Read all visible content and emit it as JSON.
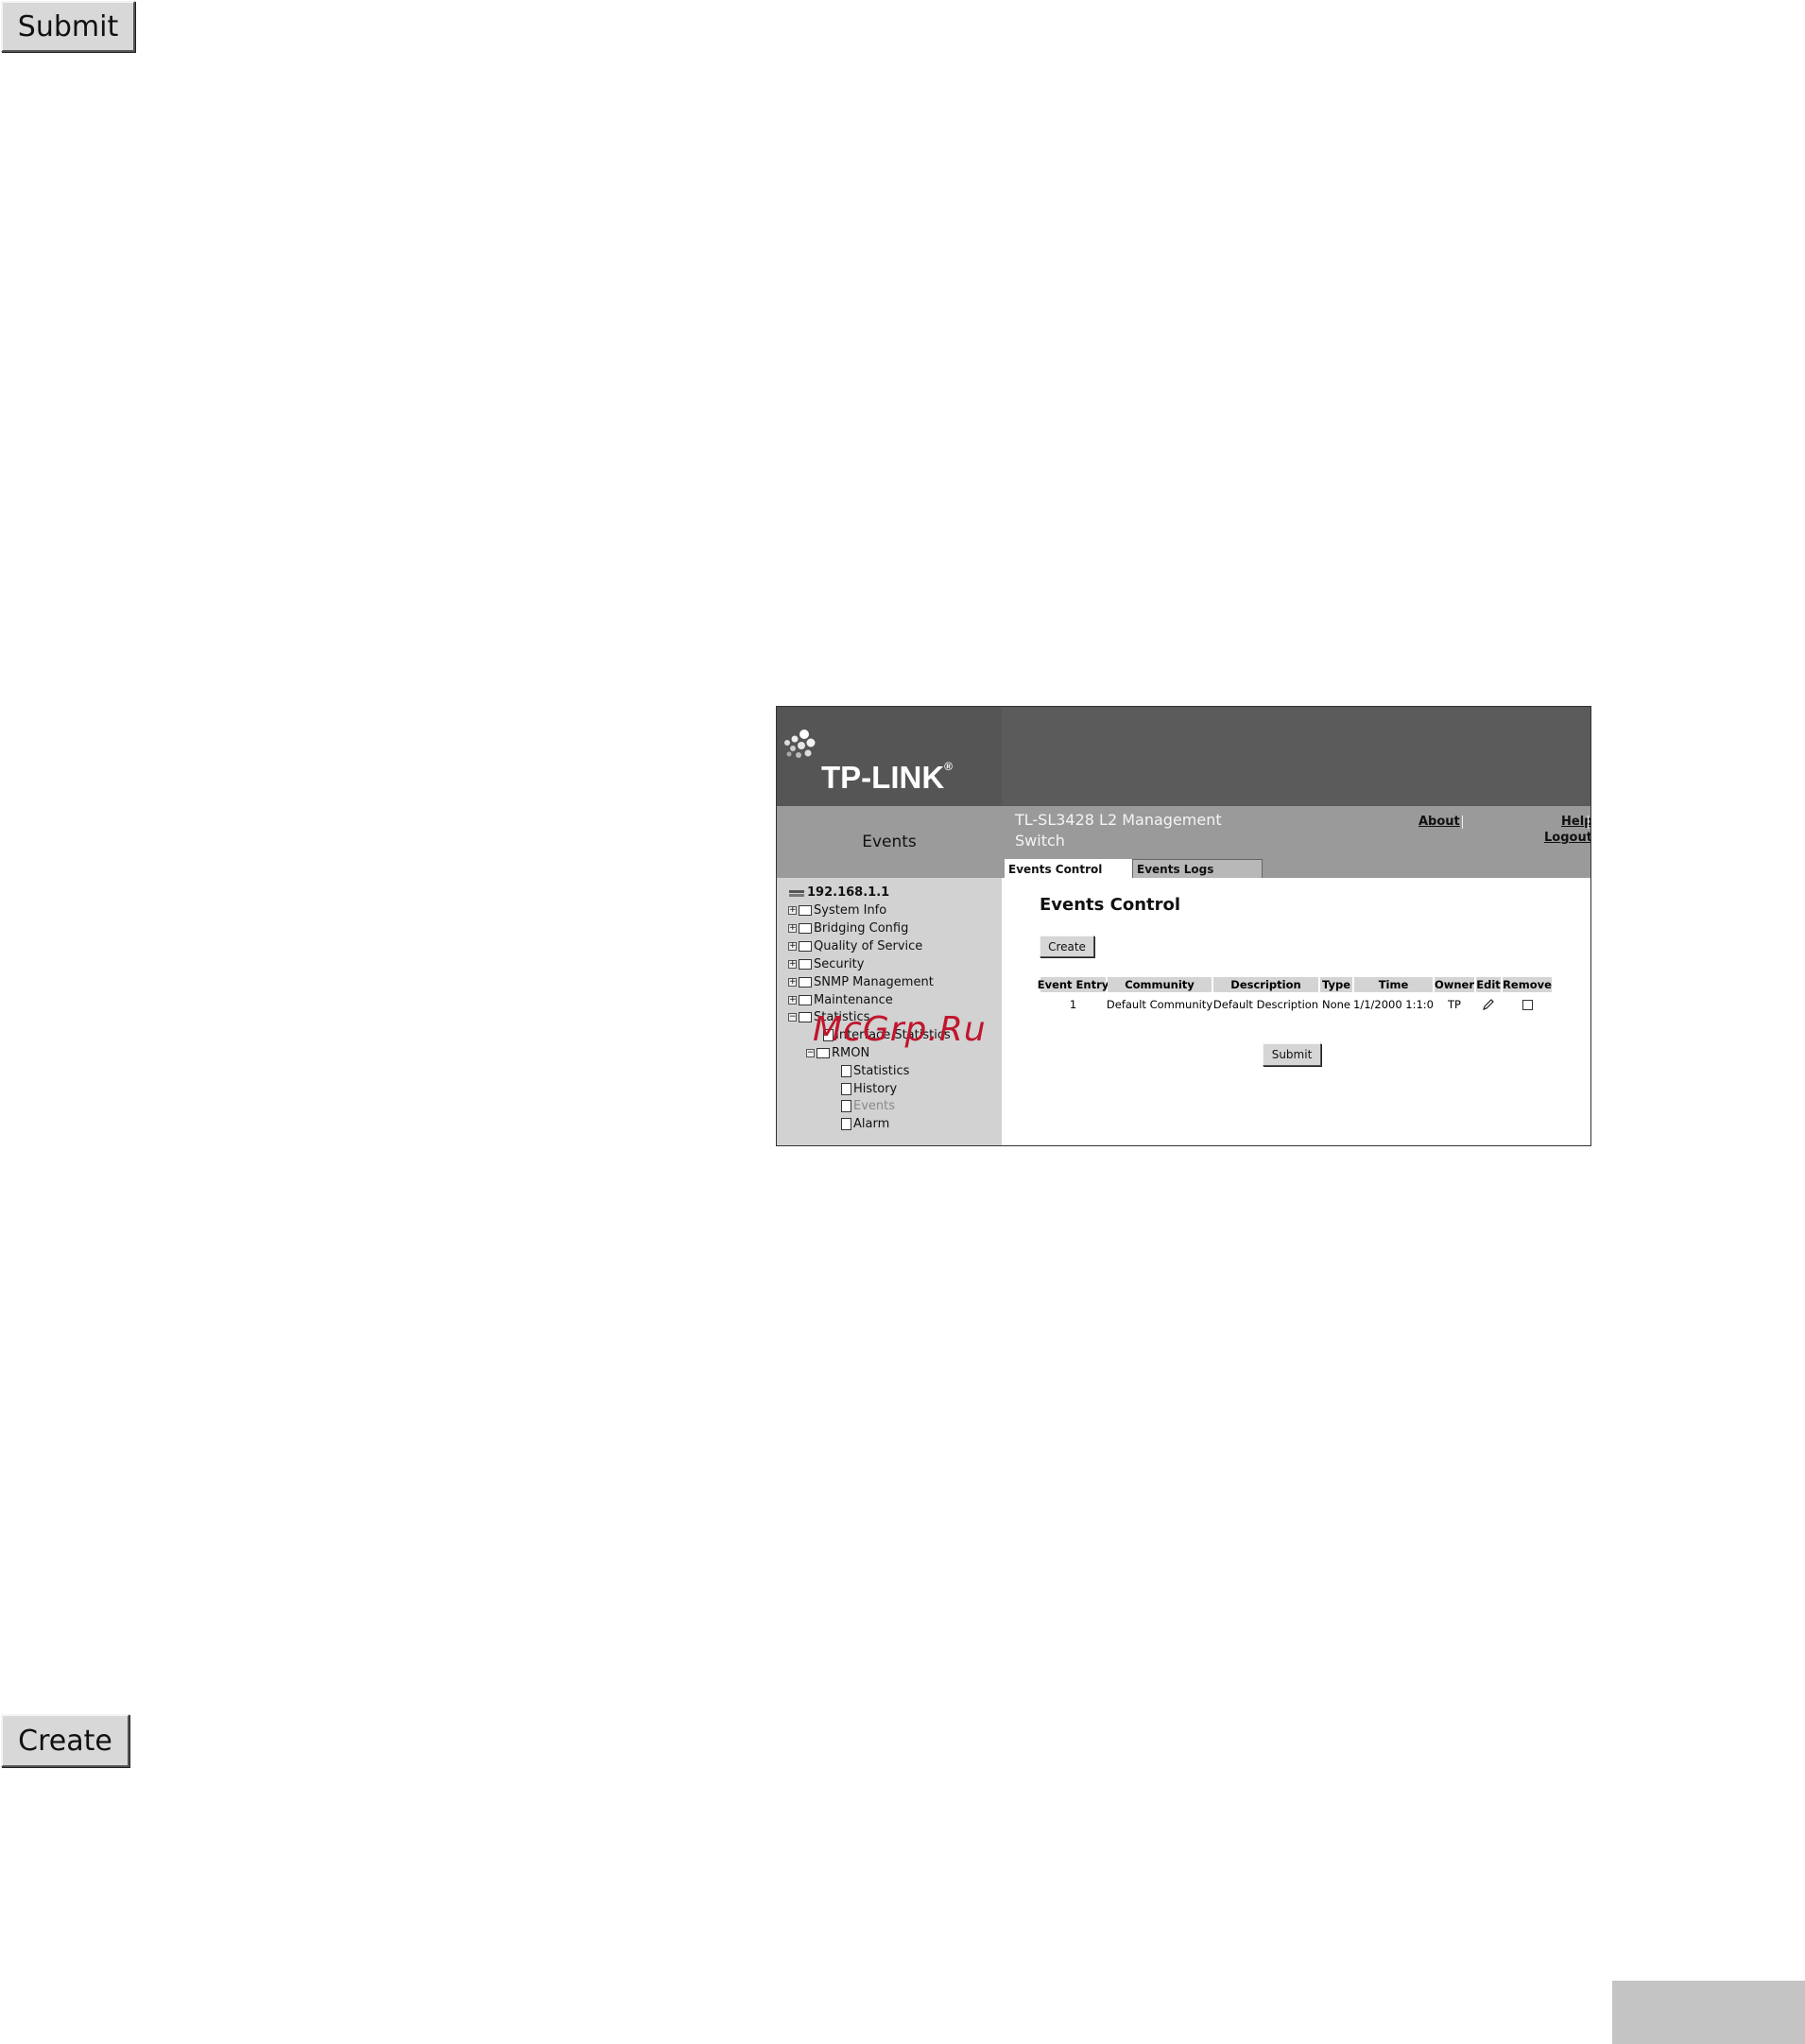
{
  "top_button": {
    "label": "Submit"
  },
  "bottom_button": {
    "label": "Create"
  },
  "screenshot": {
    "brand": "TP-LINK",
    "brand_mark": "®",
    "section_title": "Events",
    "model_line1": "TL-SL3428 L2 Management",
    "model_line2": "Switch",
    "links": {
      "about": "About",
      "help": "Help",
      "logout": "Logout"
    },
    "tabs": [
      {
        "label": "Events Control",
        "active": true
      },
      {
        "label": "Events Logs",
        "active": false
      }
    ],
    "tree": {
      "root": "192.168.1.1",
      "items": [
        "System Info",
        "Bridging Config",
        "Quality of Service",
        "Security",
        "SNMP Management",
        "Maintenance",
        "Statistics"
      ],
      "stats_children": [
        "Interface Statistics",
        "RMON"
      ],
      "rmon_children": [
        "Statistics",
        "History",
        "Events",
        "Alarm"
      ],
      "selected": "Events"
    },
    "watermark": "McGrp.Ru",
    "page_title": "Events Control",
    "create_label": "Create",
    "submit_label": "Submit",
    "table": {
      "headers": [
        "Event Entry",
        "Community",
        "Description",
        "Type",
        "Time",
        "Owner",
        "Edit",
        "Remove"
      ],
      "rows": [
        {
          "entry": "1",
          "community": "Default Community",
          "description": "Default Description",
          "type": "None",
          "time": "1/1/2000 1:1:0",
          "owner": "TP"
        }
      ]
    }
  }
}
